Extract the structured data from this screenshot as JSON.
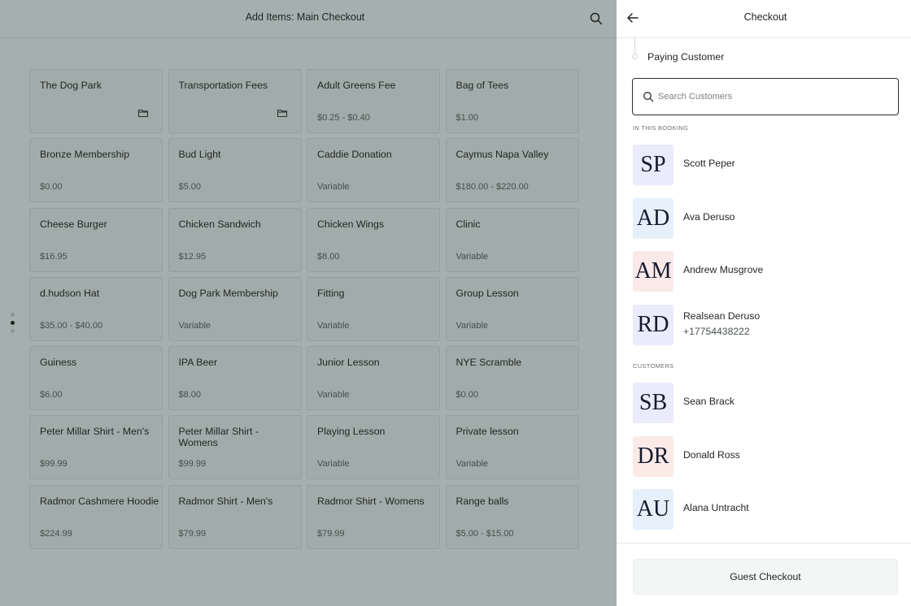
{
  "left_header": {
    "title": "Add Items: Main Checkout",
    "search_icon": "search-icon"
  },
  "items": [
    {
      "name": "The Dog Park",
      "price": "",
      "folder": true
    },
    {
      "name": "Transportation Fees",
      "price": "",
      "folder": true
    },
    {
      "name": "Adult Greens Fee",
      "price": "$0.25 - $0.40"
    },
    {
      "name": "Bag of Tees",
      "price": "$1.00"
    },
    {
      "name": "Bronze Membership",
      "price": "$0.00"
    },
    {
      "name": "Bud Light",
      "price": "$5.00"
    },
    {
      "name": "Caddie Donation",
      "price": "Variable"
    },
    {
      "name": "Caymus Napa Valley",
      "price": "$180.00 - $220.00"
    },
    {
      "name": "Cheese Burger",
      "price": "$16.95"
    },
    {
      "name": "Chicken Sandwich",
      "price": "$12.95"
    },
    {
      "name": "Chicken Wings",
      "price": "$8.00"
    },
    {
      "name": "Clinic",
      "price": "Variable"
    },
    {
      "name": "d.hudson Hat",
      "price": "$35.00 - $40.00"
    },
    {
      "name": "Dog Park Membership",
      "price": "Variable"
    },
    {
      "name": "Fitting",
      "price": "Variable"
    },
    {
      "name": "Group Lesson",
      "price": "Variable"
    },
    {
      "name": "Guiness",
      "price": "$6.00"
    },
    {
      "name": "IPA Beer",
      "price": "$8.00"
    },
    {
      "name": "Junior Lesson",
      "price": "Variable"
    },
    {
      "name": "NYE Scramble",
      "price": "$0.00"
    },
    {
      "name": "Peter Millar Shirt - Men's",
      "price": "$99.99"
    },
    {
      "name": "Peter Millar Shirt - Womens",
      "price": "$99.99"
    },
    {
      "name": "Playing Lesson",
      "price": "Variable"
    },
    {
      "name": "Private lesson",
      "price": "Variable"
    },
    {
      "name": "Radmor Cashmere Hoodie",
      "price": "$224.99"
    },
    {
      "name": "Radmor Shirt - Men's",
      "price": "$79.99"
    },
    {
      "name": "Radmor Shirt - Womens",
      "price": "$79.99"
    },
    {
      "name": "Range balls",
      "price": "$5.00 - $15.00"
    }
  ],
  "pagination": {
    "pages": 3,
    "active": 1
  },
  "drawer": {
    "title": "Checkout",
    "back_icon": "arrow-left-icon",
    "step_label": "Paying Customer",
    "search": {
      "placeholder": "Search Customers",
      "value": ""
    },
    "sections": [
      {
        "label": "IN THIS BOOKING",
        "customers": [
          {
            "initials": "SP",
            "name": "Scott Peper",
            "phone": "",
            "bg": "#ecebfb"
          },
          {
            "initials": "AD",
            "name": "Ava Deruso",
            "phone": "",
            "bg": "#e6f0fb"
          },
          {
            "initials": "AM",
            "name": "Andrew Musgrove",
            "phone": "",
            "bg": "#fbe8e8"
          },
          {
            "initials": "RD",
            "name": "Realsean Deruso",
            "phone": "+17754438222",
            "bg": "#ecebfb"
          }
        ]
      },
      {
        "label": "CUSTOMERS",
        "customers": [
          {
            "initials": "SB",
            "name": "Sean Brack",
            "phone": "",
            "bg": "#ecebfb"
          },
          {
            "initials": "DR",
            "name": "Donald Ross",
            "phone": "",
            "bg": "#fbeae6"
          },
          {
            "initials": "AU",
            "name": "Alana Untracht",
            "phone": "",
            "bg": "#e6f0fb"
          },
          {
            "initials": "",
            "name": "",
            "phone": "",
            "bg": "#fbeae6"
          }
        ]
      }
    ],
    "footer_button": "Guest Checkout"
  }
}
